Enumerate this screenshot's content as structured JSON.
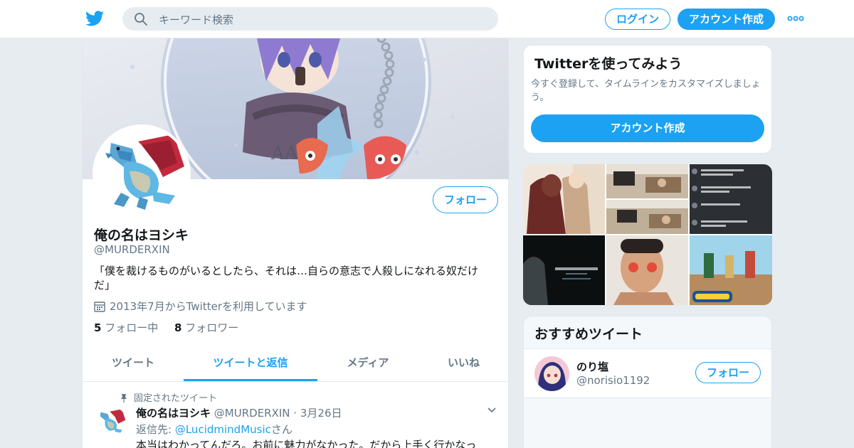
{
  "header": {
    "search_placeholder": "キーワード検索",
    "login_label": "ログイン",
    "signup_label": "アカウント作成"
  },
  "profile": {
    "name": "俺の名はヨシキ",
    "handle": "@MURDERXIN",
    "bio": "「僕を裁けるものがいるとしたら、それは…自らの意志で人殺しになれる奴だけだ」",
    "joined": "2013年7月からTwitterを利用しています",
    "following_count": "5",
    "following_label": "フォロー中",
    "followers_count": "8",
    "followers_label": "フォロワー",
    "follow_label": "フォロー"
  },
  "tabs": [
    {
      "label": "ツイート",
      "active": false
    },
    {
      "label": "ツイートと返信",
      "active": true
    },
    {
      "label": "メディア",
      "active": false
    },
    {
      "label": "いいね",
      "active": false
    }
  ],
  "tweet": {
    "pinned_label": "固定されたツイート",
    "author": "俺の名はヨシキ",
    "handle": "@MURDERXIN",
    "separator": "·",
    "date": "3月26日",
    "reply_prefix": "返信先:",
    "reply_to": "@LucidmindMusic",
    "reply_suffix": "さん",
    "text": "本当はわかってんだろ。お前に魅力がなかった。だから上手く行かなっ"
  },
  "signup_card": {
    "title": "Twitterを使ってみよう",
    "description": "今すぐ登録して、タイムラインをカスタマイズしましょう。",
    "button_label": "アカウント作成"
  },
  "recommended": {
    "title": "おすすめツイート",
    "user_name": "のり塩",
    "user_handle": "@norisio1192",
    "follow_label": "フォロー"
  },
  "colors": {
    "accent": "#1da1f2",
    "secondary_text": "#657786",
    "background": "#e6ecf0"
  }
}
